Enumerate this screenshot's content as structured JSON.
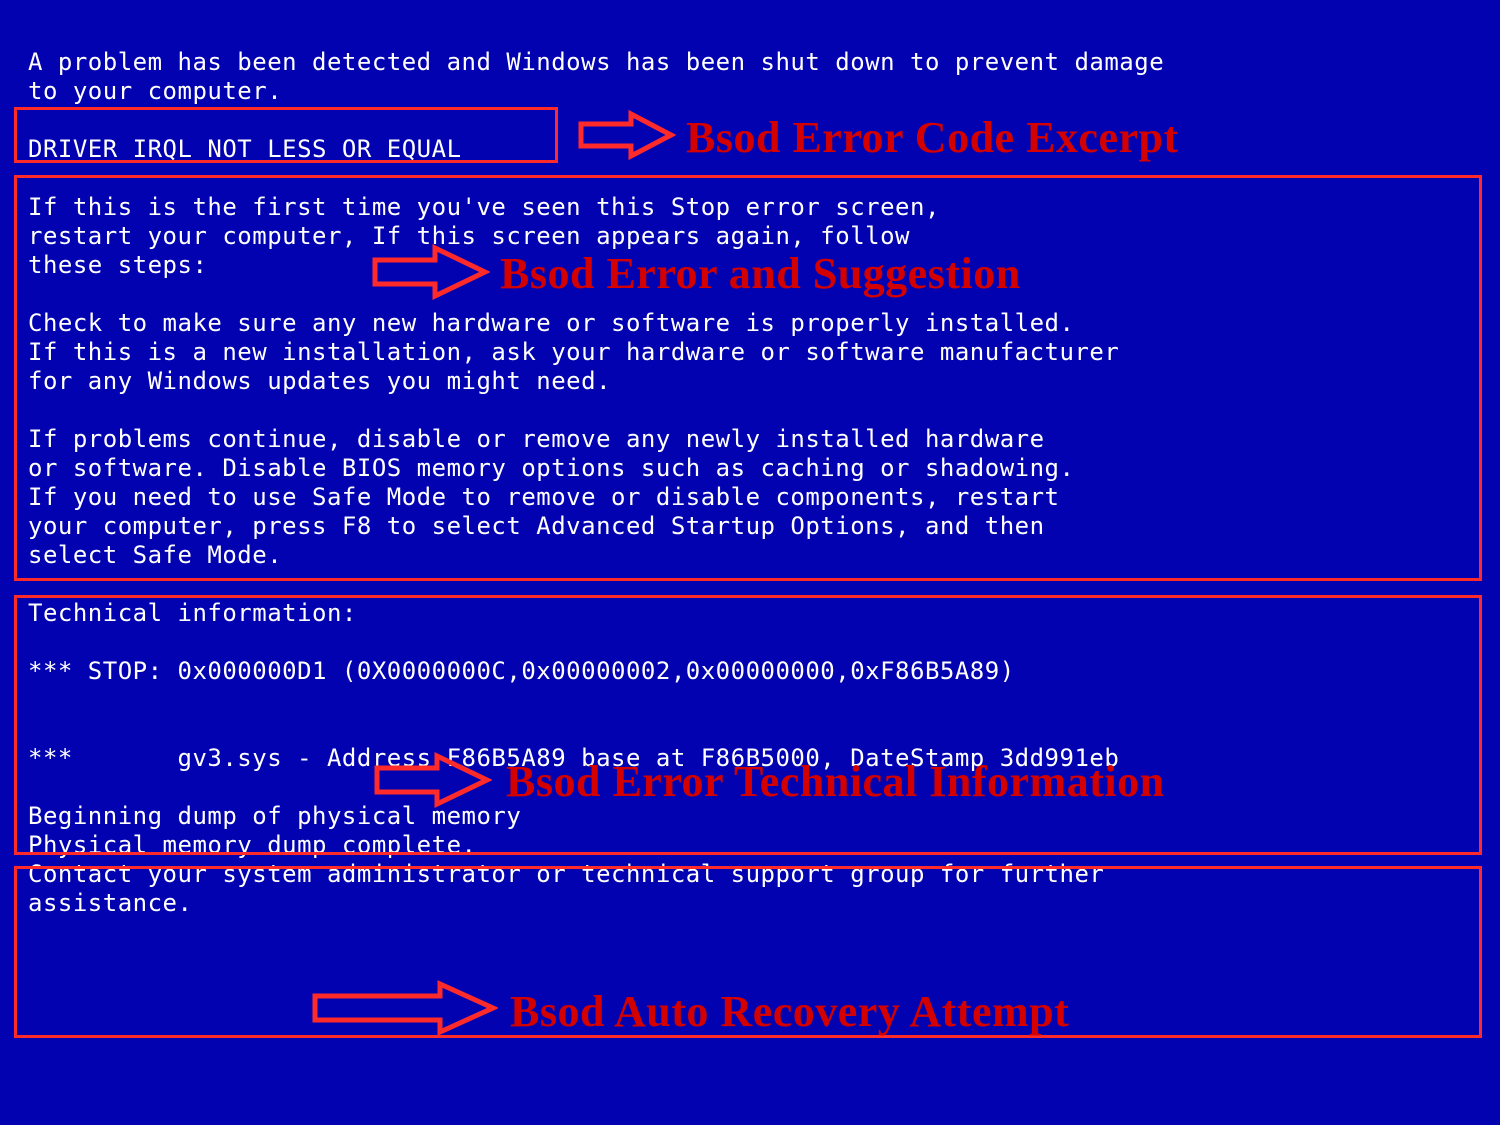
{
  "bsod": {
    "intro": "A problem has been detected and Windows has been shut down to prevent damage\nto your computer.",
    "error_code": "DRIVER_IRQL_NOT_LESS_OR_EQUAL",
    "suggest_p1": "If this is the first time you've seen this Stop error screen,\nrestart your computer, If this screen appears again, follow\nthese steps:",
    "suggest_p2": "Check to make sure any new hardware or software is properly installed.\nIf this is a new installation, ask your hardware or software manufacturer\nfor any Windows updates you might need.",
    "suggest_p3": "If problems continue, disable or remove any newly installed hardware\nor software. Disable BIOS memory options such as caching or shadowing.\nIf you need to use Safe Mode to remove or disable components, restart\nyour computer, press F8 to select Advanced Startup Options, and then\nselect Safe Mode.",
    "tech_header": "Technical information:",
    "tech_stop": "*** STOP: 0x000000D1 (0X0000000C,0x00000002,0x00000000,0xF86B5A89)",
    "tech_module": "***       gv3.sys - Address F86B5A89 base at F86B5000, DateStamp 3dd991eb",
    "dump_p1": "Beginning dump of physical memory\nPhysical memory dump complete.\nContact your system administrator or technical support group for further\nassistance."
  },
  "annotations": {
    "error_code": "Bsod Error Code Excerpt",
    "suggest": "Bsod Error and Suggestion",
    "tech": "Bsod Error Technical Information",
    "recover": "Bsod Auto Recovery Attempt"
  },
  "colors": {
    "background": "#0202b0",
    "text": "#ffffff",
    "highlight_border": "#ff2a2a",
    "annotation_text": "#d40000"
  }
}
